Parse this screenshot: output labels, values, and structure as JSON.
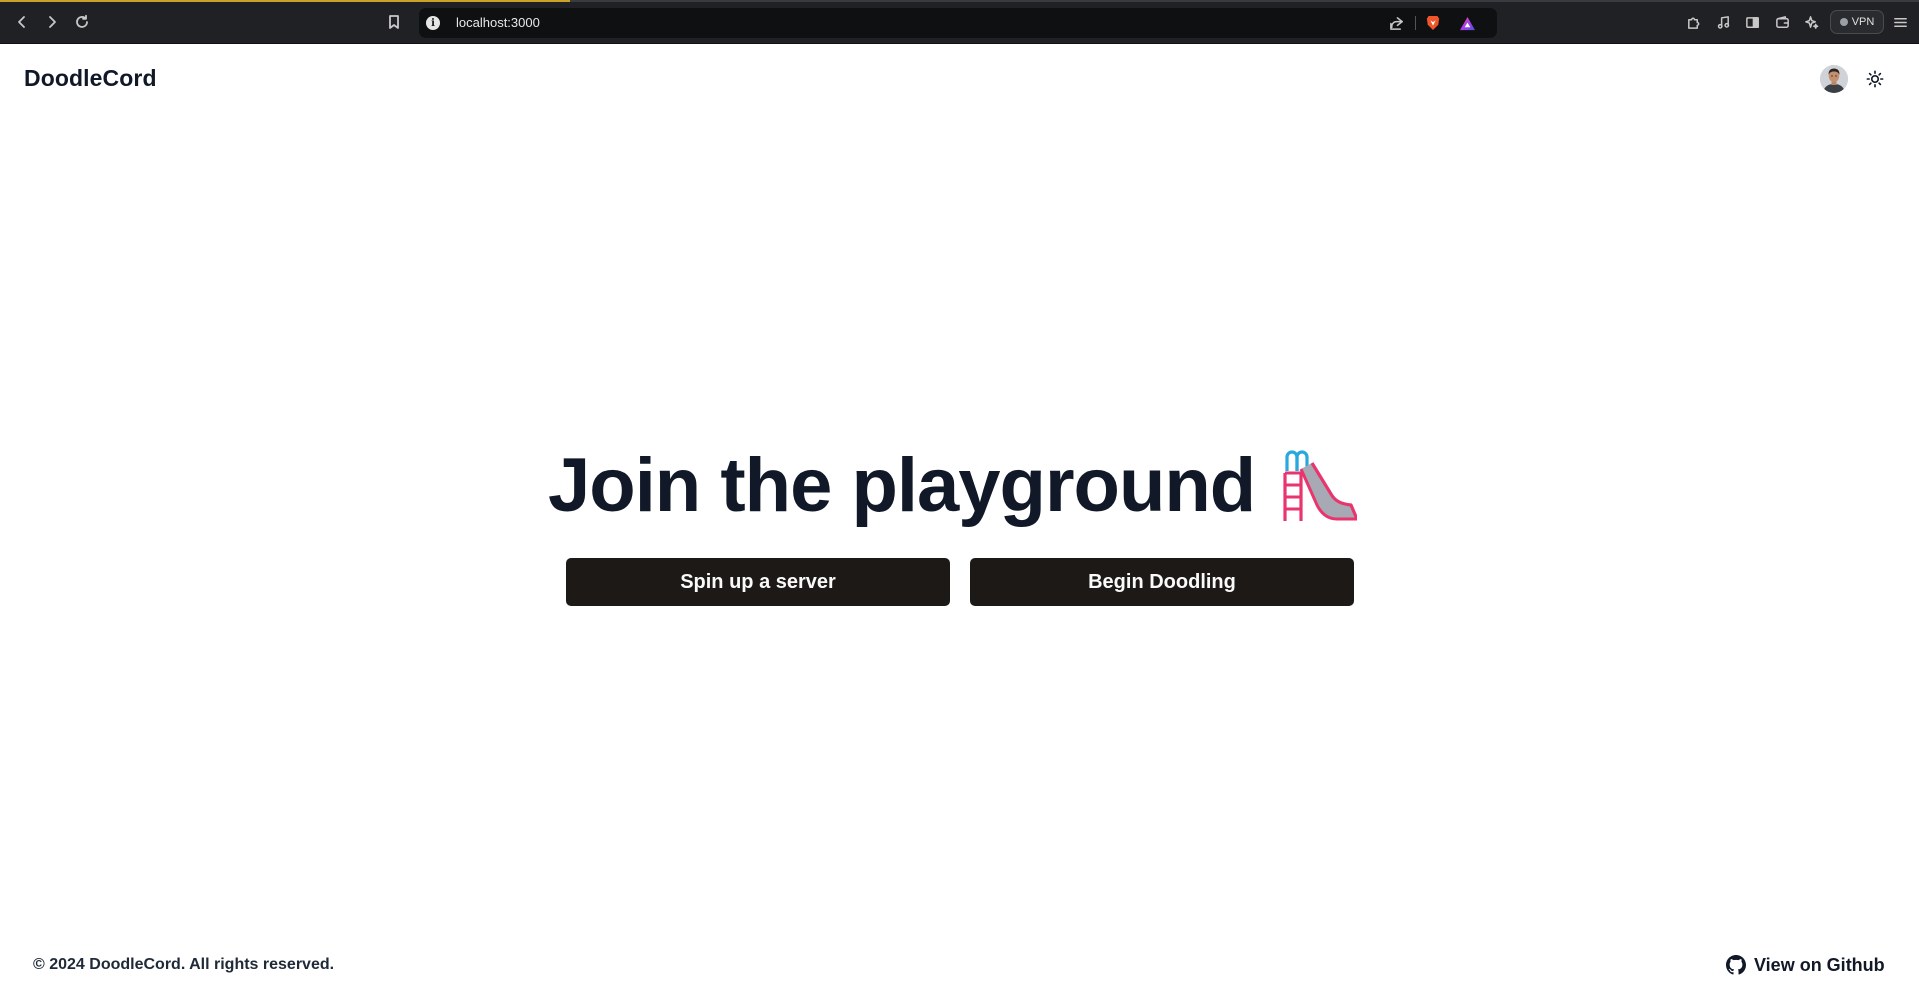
{
  "browser": {
    "url": "localhost:3000",
    "vpn_label": "VPN",
    "icons": {
      "back": "chevron-left-icon",
      "forward": "chevron-right-icon",
      "reload": "reload-icon",
      "bookmark": "bookmark-icon",
      "site_info": "info-icon",
      "share": "share-icon",
      "brave_shields": "brave-lion-icon",
      "brave_rewards": "triangle-icon",
      "extensions": "puzzle-icon",
      "media": "music-note-icon",
      "sidebar": "sidebar-icon",
      "wallet": "wallet-icon",
      "leo": "sparkle-icon",
      "menu": "hamburger-menu-icon"
    }
  },
  "header": {
    "brand": "DoodleCord",
    "icons": {
      "avatar": "avatar",
      "theme_toggle": "sun-icon"
    }
  },
  "hero": {
    "title": "Join the playground",
    "emoji": "playground-slide-icon",
    "buttons": {
      "spin_up": "Spin up a server",
      "begin": "Begin Doodling"
    }
  },
  "footer": {
    "copyright": "© 2024 DoodleCord. All rights reserved.",
    "github_label": "View on Github",
    "github_icon": "github-icon"
  },
  "colors": {
    "chrome_bg": "#202124",
    "url_bg": "#0f1012",
    "loading_bar": "#c9a227",
    "text_dark": "#111827",
    "button_bg": "#1c1917",
    "button_text": "#fafaf9",
    "slide_pink": "#e8356d",
    "slide_grey": "#a7a9b4",
    "slide_blue": "#29a8e0"
  }
}
